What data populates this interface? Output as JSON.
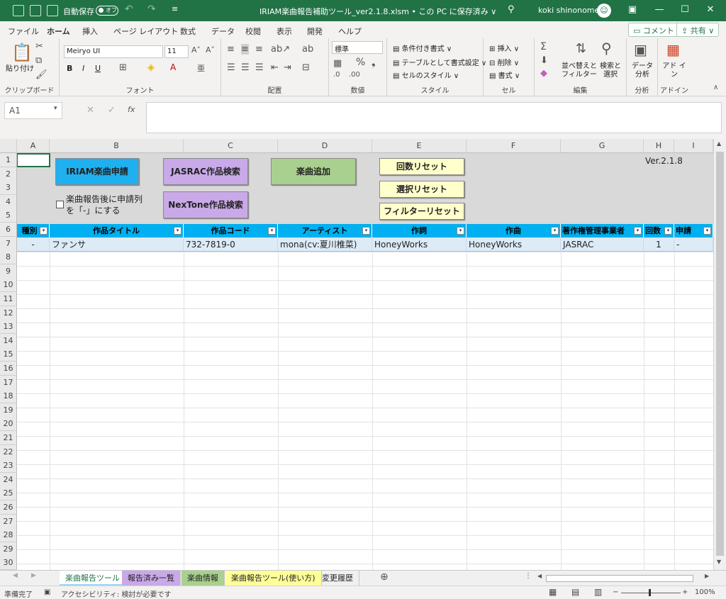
{
  "title_bar": {
    "autosave_label": "自動保存",
    "autosave_state": "オフ",
    "file_title": "IRIAM楽曲報告補助ツール_ver2.1.8.xlsm • この PC に保存済み ∨",
    "user": "koki shinonome",
    "minimize": "—",
    "restore": "☐",
    "close": "✕"
  },
  "menu": {
    "tabs": [
      "ファイル",
      "ホーム",
      "挿入",
      "ページ レイアウト",
      "数式",
      "データ",
      "校閲",
      "表示",
      "開発",
      "ヘルプ"
    ],
    "active": "ホーム",
    "comment_btn": "コメント",
    "share_btn": "共有"
  },
  "ribbon": {
    "paste": "貼り付け",
    "clipboard_label": "クリップボード",
    "font_name": "Meiryo UI",
    "font_size": "11",
    "font_label": "フォント",
    "align_label": "配置",
    "number_format": "標準",
    "number_label": "数値",
    "conditional": "条件付き書式",
    "table_format": "テーブルとして書式設定",
    "cell_style": "セルのスタイル",
    "style_label": "スタイル",
    "insert": "挿入",
    "delete": "削除",
    "format": "書式",
    "cells_label": "セル",
    "sort_filter": "並べ替えと フィルター",
    "find_select": "検索と 選択",
    "edit_label": "編集",
    "data_analysis": "データ 分析",
    "analysis_label": "分析",
    "addin": "アド イン",
    "addin_label": "アドイン"
  },
  "formula_bar": {
    "name_box": "A1",
    "fx": "fx",
    "cancel": "✕",
    "confirm": "✓"
  },
  "sheet": {
    "columns": [
      "A",
      "B",
      "C",
      "D",
      "E",
      "F",
      "G",
      "H",
      "I"
    ],
    "rows": [
      "1",
      "2",
      "3",
      "4",
      "5",
      "6",
      "7",
      "8",
      "9",
      "10",
      "11",
      "12",
      "13",
      "14",
      "15",
      "16",
      "17",
      "18",
      "19",
      "20",
      "21",
      "22",
      "23",
      "24",
      "25",
      "26",
      "27",
      "28",
      "29",
      "30"
    ],
    "buttons": {
      "iriam_apply": "IRIAM楽曲申請",
      "jasrac_search": "JASRAC作品検索",
      "add_song": "楽曲追加",
      "nextone_search": "NexTone作品検索",
      "count_reset": "回数リセット",
      "selection_reset": "選択リセット",
      "filter_reset": "フィルターリセット"
    },
    "version": "Ver.2.1.8",
    "checkbox_label_1": "楽曲報告後に申請列",
    "checkbox_label_2": "を「-」にする",
    "table_headers": [
      "種別",
      "作品タイトル",
      "作品コード",
      "アーティスト",
      "作詞",
      "作曲",
      "著作権管理事業者",
      "回数",
      "申請"
    ],
    "table_rows": [
      [
        "-",
        "ファンサ",
        "732-7819-0",
        "mona(cv:夏川椎菜)",
        "HoneyWorks",
        "HoneyWorks",
        "JASRAC",
        "1",
        "-"
      ]
    ]
  },
  "sheet_tabs": [
    "楽曲報告ツール",
    "報告済み一覧",
    "楽曲情報",
    "楽曲報告ツール(使い方)",
    "変更履歴"
  ],
  "sheet_tab_colors": [
    "#9bd7f3",
    "#c9a9e8",
    "#a9d08e",
    "#ffff99",
    "#f0f0f0"
  ],
  "status_bar": {
    "ready": "準備完了",
    "accessibility": "アクセシビリティ: 検討が必要です",
    "zoom": "100%"
  },
  "colors": {
    "excel_green": "#217346",
    "header_blue": "#00b0f0",
    "row_fill": "#ddebf7",
    "btn_blue": "#1fb0f0",
    "btn_purple": "#c9a9e8",
    "btn_green": "#a9d08e",
    "btn_yellow": "#ffffcc"
  }
}
